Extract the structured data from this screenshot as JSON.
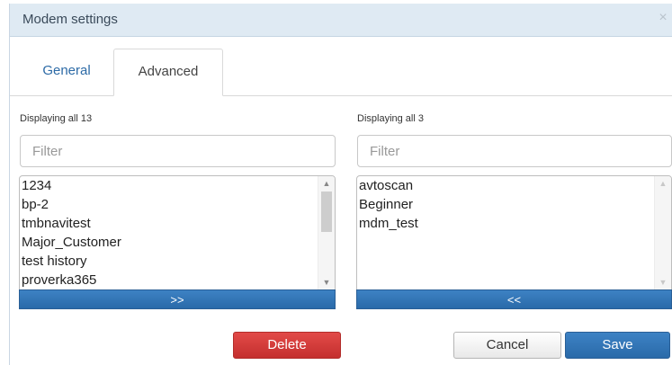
{
  "dialog": {
    "title": "Modem settings",
    "close_glyph": "×"
  },
  "tabs": [
    {
      "label": "General",
      "active": false
    },
    {
      "label": "Advanced",
      "active": true
    }
  ],
  "left_panel": {
    "caption": "Displaying all 13",
    "filter_placeholder": "Filter",
    "items": [
      "1234",
      "bp-2",
      "tmbnavitest",
      "Major_Customer",
      "test history",
      "proverka365"
    ],
    "move_label": ">>"
  },
  "right_panel": {
    "caption": "Displaying all 3",
    "filter_placeholder": "Filter",
    "items": [
      "avtoscan",
      "Beginner",
      "mdm_test"
    ],
    "move_label": "<<"
  },
  "buttons": {
    "delete": "Delete",
    "cancel": "Cancel",
    "save": "Save"
  },
  "colors": {
    "accent": "#2f73b5",
    "danger": "#d13c3a",
    "titlebar": "#dfeaf3"
  },
  "icons": {
    "scroll_up": "chevron-up-icon",
    "scroll_down": "chevron-down-icon",
    "close": "close-icon"
  }
}
